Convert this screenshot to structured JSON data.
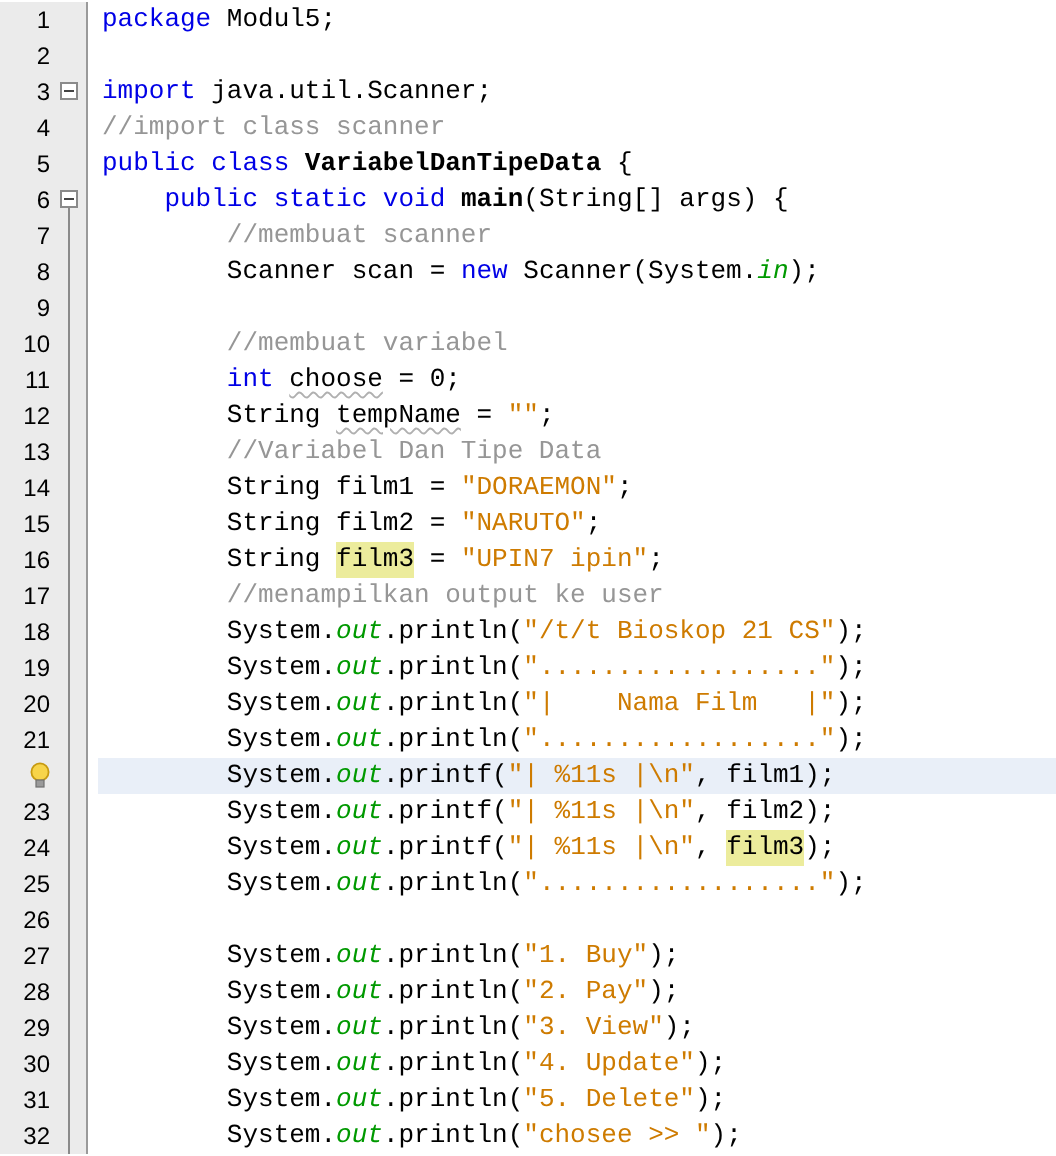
{
  "lines": [
    {
      "number": "1",
      "tokens": [
        {
          "text": "package",
          "kind": "keyword"
        },
        {
          "text": " Modul5;",
          "kind": "plain"
        }
      ]
    },
    {
      "number": "2"
    },
    {
      "number": "3",
      "fold": {
        "expanded": true,
        "extends": false
      },
      "tokens": [
        {
          "text": "import",
          "kind": "keyword"
        },
        {
          "text": " java.util.Scanner;",
          "kind": "plain"
        }
      ]
    },
    {
      "number": "4",
      "tokens": [
        {
          "text": "//import class scanner",
          "kind": "comment"
        }
      ]
    },
    {
      "number": "5",
      "tokens": [
        {
          "text": "public class ",
          "kind": "keyword"
        },
        {
          "text": "VariabelDanTipeData",
          "kind": "declaration"
        },
        {
          "text": " {",
          "kind": "plain"
        }
      ]
    },
    {
      "number": "6",
      "fold": {
        "expanded": true,
        "extends": true
      },
      "tokens": [
        {
          "text": "    public static void ",
          "kind": "keyword"
        },
        {
          "text": "main",
          "kind": "declaration"
        },
        {
          "text": "(String[] args) {",
          "kind": "plain"
        }
      ]
    },
    {
      "number": "7",
      "tokens": [
        {
          "text": "        //membuat scanner",
          "kind": "comment"
        }
      ]
    },
    {
      "number": "8",
      "tokens": [
        {
          "text": "        Scanner scan = ",
          "kind": "plain"
        },
        {
          "text": "new",
          "kind": "keyword"
        },
        {
          "text": " Scanner(System.",
          "kind": "plain"
        },
        {
          "text": "in",
          "kind": "field"
        },
        {
          "text": ");",
          "kind": "plain"
        }
      ]
    },
    {
      "number": "9"
    },
    {
      "number": "10",
      "tokens": [
        {
          "text": "        //membuat variabel",
          "kind": "comment"
        }
      ]
    },
    {
      "number": "11",
      "tokens": [
        {
          "text": "        int ",
          "kind": "keyword"
        },
        {
          "text": "choose",
          "kind": "warning"
        },
        {
          "text": " = 0;",
          "kind": "plain"
        }
      ]
    },
    {
      "number": "12",
      "tokens": [
        {
          "text": "        String ",
          "kind": "plain"
        },
        {
          "text": "tempName",
          "kind": "warning"
        },
        {
          "text": " = ",
          "kind": "plain"
        },
        {
          "text": "\"\"",
          "kind": "string"
        },
        {
          "text": ";",
          "kind": "plain"
        }
      ]
    },
    {
      "number": "13",
      "tokens": [
        {
          "text": "        //Variabel Dan Tipe Data",
          "kind": "comment"
        }
      ]
    },
    {
      "number": "14",
      "tokens": [
        {
          "text": "        String film1 = ",
          "kind": "plain"
        },
        {
          "text": "\"DORAEMON\"",
          "kind": "string"
        },
        {
          "text": ";",
          "kind": "plain"
        }
      ]
    },
    {
      "number": "15",
      "tokens": [
        {
          "text": "        String film2 = ",
          "kind": "plain"
        },
        {
          "text": "\"NARUTO\"",
          "kind": "string"
        },
        {
          "text": ";",
          "kind": "plain"
        }
      ]
    },
    {
      "number": "16",
      "tokens": [
        {
          "text": "        String ",
          "kind": "plain"
        },
        {
          "text": "film3",
          "kind": "occurrence"
        },
        {
          "text": " = ",
          "kind": "plain"
        },
        {
          "text": "\"UPIN7 ipin\"",
          "kind": "string"
        },
        {
          "text": ";",
          "kind": "plain"
        }
      ]
    },
    {
      "number": "17",
      "tokens": [
        {
          "text": "        //menampilkan output ke user",
          "kind": "comment"
        }
      ]
    },
    {
      "number": "18",
      "tokens": [
        {
          "text": "        System.",
          "kind": "plain"
        },
        {
          "text": "out",
          "kind": "field"
        },
        {
          "text": ".println(",
          "kind": "plain"
        },
        {
          "text": "\"/t/t Bioskop 21 CS\"",
          "kind": "string"
        },
        {
          "text": ");",
          "kind": "plain"
        }
      ]
    },
    {
      "number": "19",
      "tokens": [
        {
          "text": "        System.",
          "kind": "plain"
        },
        {
          "text": "out",
          "kind": "field"
        },
        {
          "text": ".println(",
          "kind": "plain"
        },
        {
          "text": "\"..................\"",
          "kind": "string"
        },
        {
          "text": ");",
          "kind": "plain"
        }
      ]
    },
    {
      "number": "20",
      "tokens": [
        {
          "text": "        System.",
          "kind": "plain"
        },
        {
          "text": "out",
          "kind": "field"
        },
        {
          "text": ".println(",
          "kind": "plain"
        },
        {
          "text": "\"|    Nama Film   |\"",
          "kind": "string"
        },
        {
          "text": ");",
          "kind": "plain"
        }
      ]
    },
    {
      "number": "21",
      "tokens": [
        {
          "text": "        System.",
          "kind": "plain"
        },
        {
          "text": "out",
          "kind": "field"
        },
        {
          "text": ".println(",
          "kind": "plain"
        },
        {
          "text": "\"..................\"",
          "kind": "string"
        },
        {
          "text": ");",
          "kind": "plain"
        }
      ]
    },
    {
      "hint": true,
      "current": true,
      "tokens": [
        {
          "text": "        System.",
          "kind": "plain"
        },
        {
          "text": "out",
          "kind": "field"
        },
        {
          "text": ".printf(",
          "kind": "plain"
        },
        {
          "text": "\"| %11s |\\n\"",
          "kind": "string"
        },
        {
          "text": ", film1);",
          "kind": "plain"
        }
      ]
    },
    {
      "number": "23",
      "tokens": [
        {
          "text": "        System.",
          "kind": "plain"
        },
        {
          "text": "out",
          "kind": "field"
        },
        {
          "text": ".printf(",
          "kind": "plain"
        },
        {
          "text": "\"| %11s |\\n\"",
          "kind": "string"
        },
        {
          "text": ", film2);",
          "kind": "plain"
        }
      ]
    },
    {
      "number": "24",
      "tokens": [
        {
          "text": "        System.",
          "kind": "plain"
        },
        {
          "text": "out",
          "kind": "field"
        },
        {
          "text": ".printf(",
          "kind": "plain"
        },
        {
          "text": "\"| %11s |\\n\"",
          "kind": "string"
        },
        {
          "text": ", ",
          "kind": "plain"
        },
        {
          "text": "film3",
          "kind": "occurrence"
        },
        {
          "text": ");",
          "kind": "plain"
        }
      ]
    },
    {
      "number": "25",
      "tokens": [
        {
          "text": "        System.",
          "kind": "plain"
        },
        {
          "text": "out",
          "kind": "field"
        },
        {
          "text": ".println(",
          "kind": "plain"
        },
        {
          "text": "\"..................\"",
          "kind": "string"
        },
        {
          "text": ");",
          "kind": "plain"
        }
      ]
    },
    {
      "number": "26"
    },
    {
      "number": "27",
      "tokens": [
        {
          "text": "        System.",
          "kind": "plain"
        },
        {
          "text": "out",
          "kind": "field"
        },
        {
          "text": ".println(",
          "kind": "plain"
        },
        {
          "text": "\"1. Buy\"",
          "kind": "string"
        },
        {
          "text": ");",
          "kind": "plain"
        }
      ]
    },
    {
      "number": "28",
      "tokens": [
        {
          "text": "        System.",
          "kind": "plain"
        },
        {
          "text": "out",
          "kind": "field"
        },
        {
          "text": ".println(",
          "kind": "plain"
        },
        {
          "text": "\"2. Pay\"",
          "kind": "string"
        },
        {
          "text": ");",
          "kind": "plain"
        }
      ]
    },
    {
      "number": "29",
      "tokens": [
        {
          "text": "        System.",
          "kind": "plain"
        },
        {
          "text": "out",
          "kind": "field"
        },
        {
          "text": ".println(",
          "kind": "plain"
        },
        {
          "text": "\"3. View\"",
          "kind": "string"
        },
        {
          "text": ");",
          "kind": "plain"
        }
      ]
    },
    {
      "number": "30",
      "tokens": [
        {
          "text": "        System.",
          "kind": "plain"
        },
        {
          "text": "out",
          "kind": "field"
        },
        {
          "text": ".println(",
          "kind": "plain"
        },
        {
          "text": "\"4. Update\"",
          "kind": "string"
        },
        {
          "text": ");",
          "kind": "plain"
        }
      ]
    },
    {
      "number": "31",
      "tokens": [
        {
          "text": "        System.",
          "kind": "plain"
        },
        {
          "text": "out",
          "kind": "field"
        },
        {
          "text": ".println(",
          "kind": "plain"
        },
        {
          "text": "\"5. Delete\"",
          "kind": "string"
        },
        {
          "text": ");",
          "kind": "plain"
        }
      ]
    },
    {
      "number": "32",
      "tokens": [
        {
          "text": "        System.",
          "kind": "plain"
        },
        {
          "text": "out",
          "kind": "field"
        },
        {
          "text": ".println(",
          "kind": "plain"
        },
        {
          "text": "\"chosee >> \"",
          "kind": "string"
        },
        {
          "text": ");",
          "kind": "plain"
        }
      ]
    }
  ]
}
